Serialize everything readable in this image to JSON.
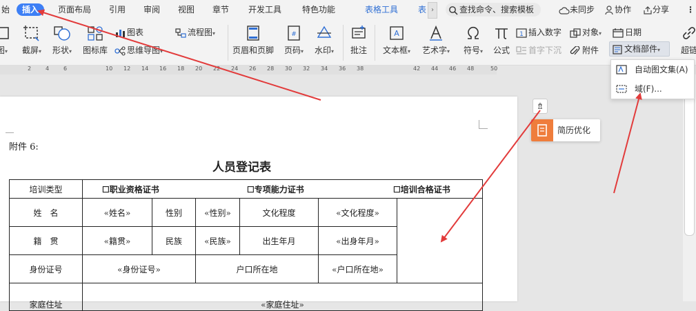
{
  "tabs": [
    {
      "label": "始",
      "active": false
    },
    {
      "label": "插入",
      "active": true
    },
    {
      "label": "页面布局",
      "active": false
    },
    {
      "label": "引用",
      "active": false
    },
    {
      "label": "审阅",
      "active": false
    },
    {
      "label": "视图",
      "active": false
    },
    {
      "label": "章节",
      "active": false
    },
    {
      "label": "开发工具",
      "active": false
    },
    {
      "label": "特色功能",
      "active": false
    },
    {
      "label": "表格工具",
      "active": false
    },
    {
      "label": "表",
      "active": false
    }
  ],
  "search": {
    "label": "查找命令、搜索模板"
  },
  "right_tools": {
    "sync": "未同步",
    "collab": "协作",
    "share": "分享"
  },
  "ribbon": {
    "r1": "图",
    "screenshot": "截屏",
    "shape": "形状",
    "icon_lib": "图标库",
    "chart": "图表",
    "mindmap": "思维导图",
    "flowchart": "流程图",
    "header_footer": "页眉和页脚",
    "page_num": "页码",
    "watermark": "水印",
    "comment": "批注",
    "textbox": "文本框",
    "wordart": "艺术字",
    "symbol": "符号",
    "formula": "公式",
    "insert_number": "插入数字",
    "object": "对象",
    "date": "日期",
    "drop_cap": "首字下沉",
    "attachment": "附件",
    "doc_parts": "文档部件",
    "hyperlink": "超链"
  },
  "ruler_ticks": [
    "2",
    "4",
    "6",
    "10",
    "12",
    "14",
    "16",
    "18",
    "20",
    "22",
    "24",
    "26",
    "28",
    "30",
    "32",
    "34",
    "36",
    "38",
    "42",
    "44",
    "46",
    "48",
    "50"
  ],
  "dropdown": {
    "autotext": "自动图文集(A)",
    "field": "域(F)..."
  },
  "resume": {
    "label": "简历优化"
  },
  "doc": {
    "annex": "附件 6:",
    "title": "人员登记表",
    "table": {
      "r1": {
        "label": "培训类型",
        "opt1": "☐职业资格证书",
        "opt2": "☐专项能力证书",
        "opt3": "☐培训合格证书"
      },
      "r2": {
        "name_label": "姓　名",
        "name_value": "«姓名»",
        "gender_label": "性别",
        "gender_value": "«性别»",
        "edu_label": "文化程度",
        "edu_value": "«文化程度»"
      },
      "r3": {
        "native_label": "籍　贯",
        "native_value": "«籍贯»",
        "ethnic_label": "民族",
        "ethnic_value": "«民族»",
        "birth_label": "出生年月",
        "birth_value": "«出身年月»"
      },
      "r4": {
        "id_label": "身份证号",
        "id_value": "«身份证号»",
        "hukou_label": "户口所在地",
        "hukou_value": "«户口所在地»"
      },
      "r5": {
        "addr_label": "家庭住址",
        "addr_value": "«家庭住址»"
      }
    }
  },
  "colors": {
    "accent": "#3d7ff5",
    "arrow": "#e23b3b",
    "resume_icon": "#ef7d3c"
  }
}
